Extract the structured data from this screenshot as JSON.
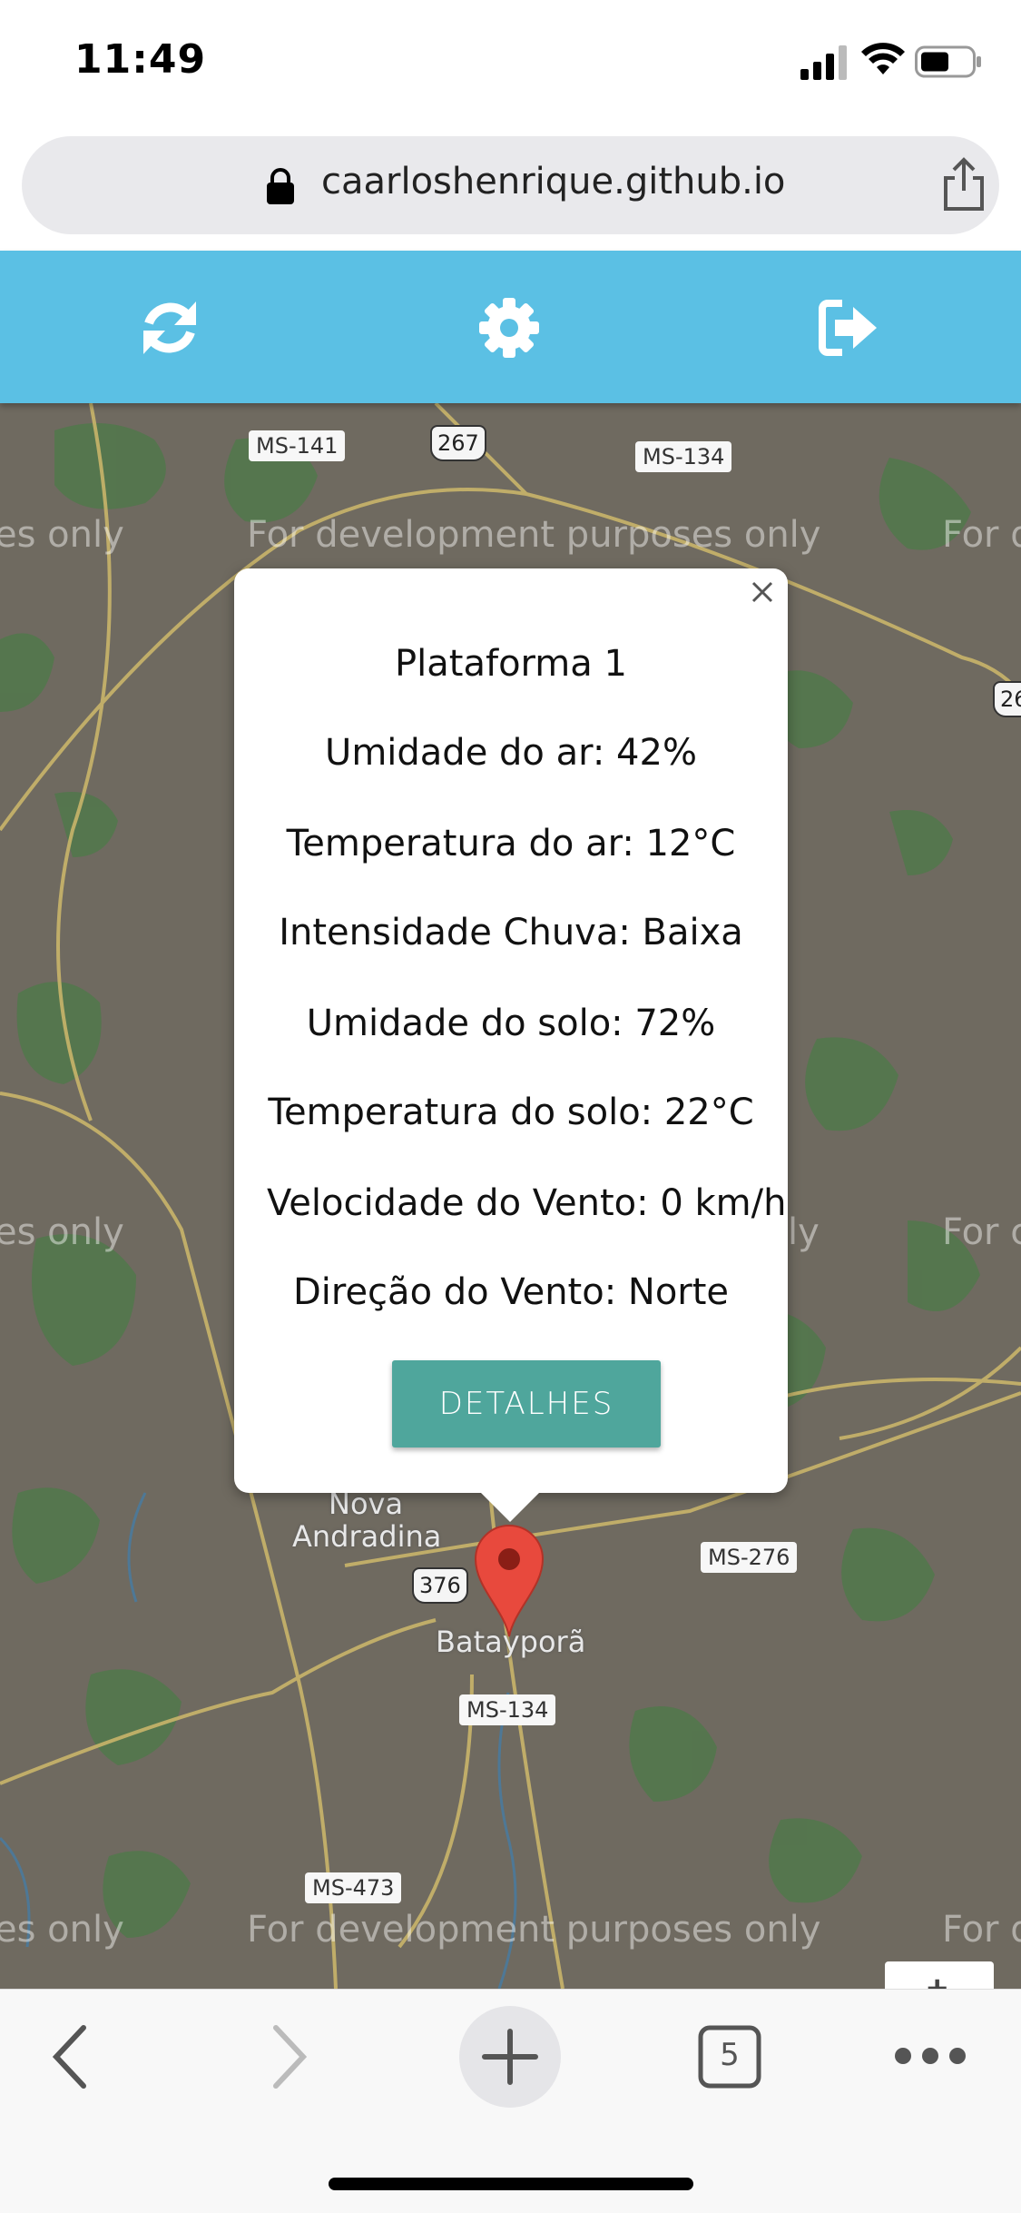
{
  "status_bar": {
    "time": "11:49"
  },
  "browser": {
    "url": "caarloshenrique.github.io",
    "tab_count": "5"
  },
  "app_toolbar": {
    "icons": [
      "refresh-icon",
      "gear-icon",
      "sign-out-icon"
    ],
    "color": "#5bc0e4"
  },
  "map": {
    "watermark": "For development purposes only",
    "watermark_partial_left": "es only",
    "watermark_partial_right": "For d",
    "watermark_partial_right2": "For c",
    "watermark_partial_ly": "ly",
    "roads": [
      "MS-141",
      "267",
      "MS-134",
      "MS-276",
      "376",
      "MS-134",
      "MS-473",
      "26"
    ],
    "places": [
      "Nova",
      "Andradina",
      "Batayporã"
    ],
    "zoom_label": "+"
  },
  "popup": {
    "title": "Plataforma 1",
    "lines": [
      "Umidade do ar: 42%",
      "Temperatura do ar: 12°C",
      "Intensidade Chuva: Baixa",
      "Umidade do solo: 72%",
      "Temperatura do solo: 22°C",
      "Velocidade do Vento: 0 km/h",
      "Direção do Vento: Norte"
    ],
    "button_label": "DETALHES",
    "button_color": "#4fa69c"
  }
}
